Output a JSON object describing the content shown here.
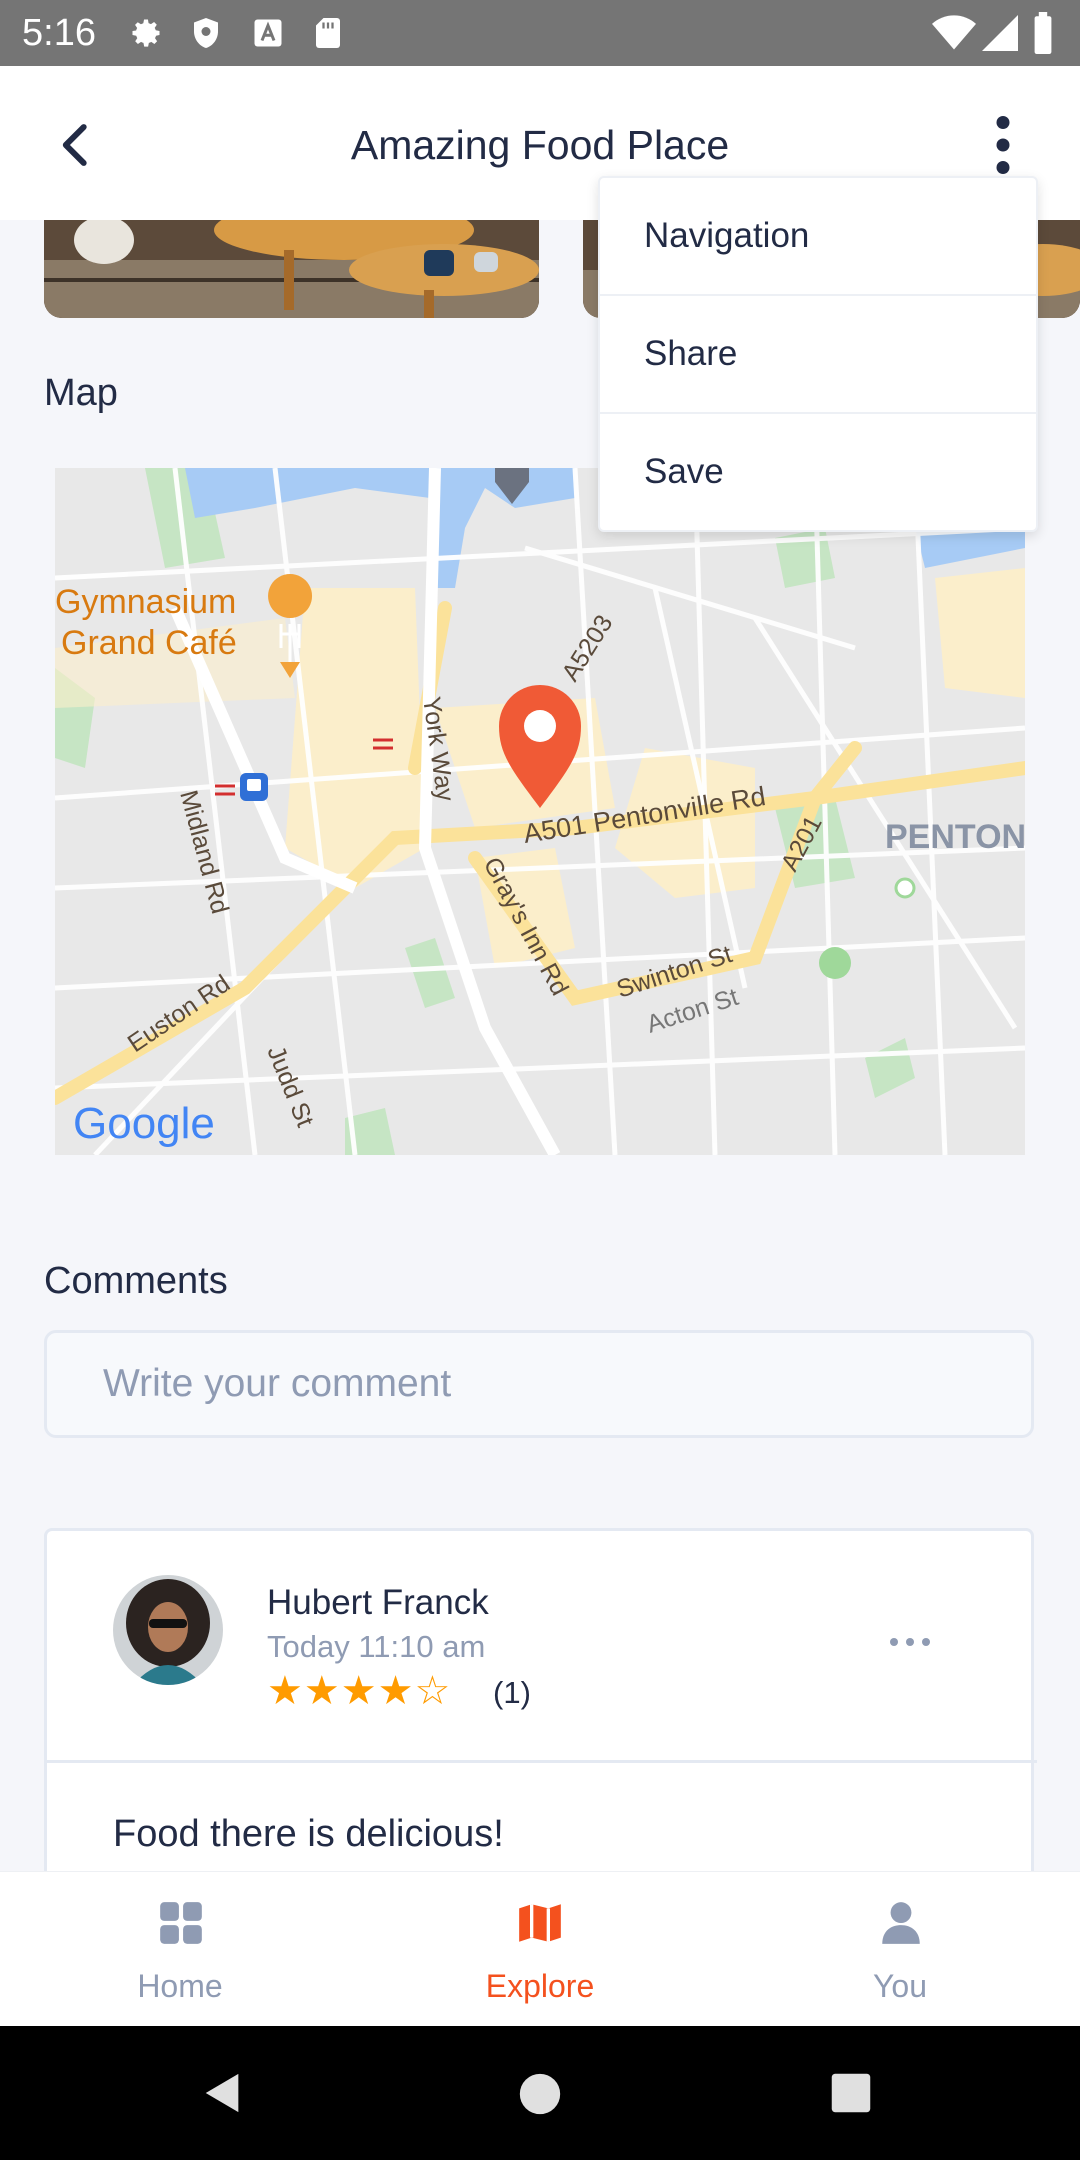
{
  "status_bar": {
    "time": "5:16"
  },
  "header": {
    "title": "Amazing Food Place"
  },
  "map_section": {
    "label": "Map",
    "labels": {
      "poi": "Gymnasium",
      "poi2": "Grand Café",
      "york_way": "York Way",
      "a5203": "A5203",
      "pentonville": "A501 Pentonville Rd",
      "penton": "PENTON",
      "midland": "Midland Rd",
      "grays": "Gray's Inn Rd",
      "a201": "A201",
      "euston": "Euston Rd",
      "swinton": "Swinton St",
      "acton": "Acton St",
      "judd": "Judd St",
      "google": "Google"
    }
  },
  "comments_section": {
    "label": "Comments",
    "input_placeholder": "Write your comment"
  },
  "comment": {
    "author": "Hubert Franck",
    "time": "Today 11:10 am",
    "rating": 4,
    "rating_max": 5,
    "stars": "★★★★☆",
    "rating_count": "(1)",
    "text": "Food there is delicious!"
  },
  "menu": {
    "items": [
      "Navigation",
      "Share",
      "Save"
    ]
  },
  "bottom_nav": {
    "items": [
      {
        "label": "Home",
        "icon": "grid-icon",
        "active": false
      },
      {
        "label": "Explore",
        "icon": "map-icon",
        "active": true
      },
      {
        "label": "You",
        "icon": "person-icon",
        "active": false
      }
    ],
    "active_color": "#f4511e",
    "inactive_color": "#8f9bb3"
  },
  "colors": {
    "accent": "#f4511e",
    "star": "#ff9b00",
    "pin": "#f05a36"
  }
}
